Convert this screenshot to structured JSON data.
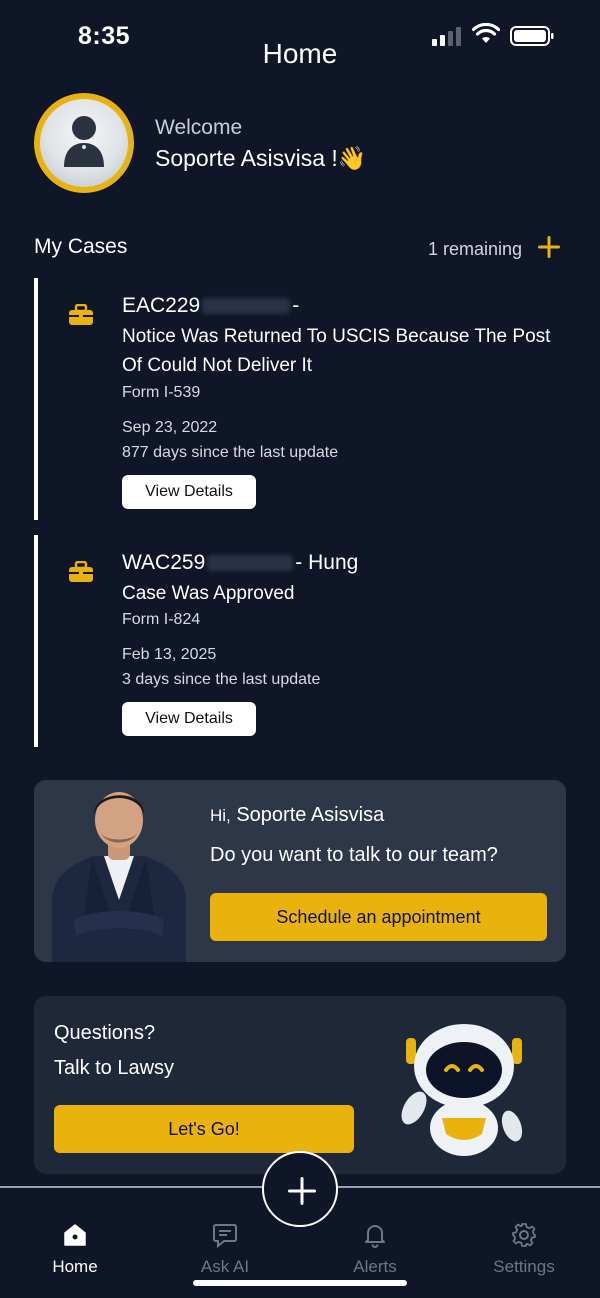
{
  "status_bar": {
    "time": "8:35"
  },
  "header": {
    "title": "Home"
  },
  "profile": {
    "welcome": "Welcome",
    "name": "Soporte Asisvisa !",
    "wave": "👋"
  },
  "cases_section": {
    "title": "My Cases",
    "remaining": "1 remaining"
  },
  "cases": [
    {
      "id_prefix": "EAC229",
      "id_suffix": "-",
      "status": "Notice Was Returned To USCIS Because The Post Of Could Not Deliver It",
      "form": "Form I-539",
      "date": "Sep 23, 2022",
      "days": "877 days since the last update",
      "button": "View Details"
    },
    {
      "id_prefix": "WAC259",
      "id_suffix": "- Hung",
      "status": "Case Was Approved",
      "form": "Form I-824",
      "date": "Feb 13, 2025",
      "days": "3 days since the last update",
      "button": "View Details"
    }
  ],
  "promo": {
    "hi_prefix": "Hi,",
    "hi_name": "Soporte Asisvisa",
    "question": "Do you want to talk to our team?",
    "button": "Schedule an appointment"
  },
  "lawsy": {
    "line1": "Questions?",
    "line2": "Talk to Lawsy",
    "button": "Let's Go!"
  },
  "tabs": [
    {
      "label": "Home",
      "icon": "home-icon",
      "active": true
    },
    {
      "label": "Ask AI",
      "icon": "chat-ai-icon",
      "active": false
    },
    {
      "label": "Alerts",
      "icon": "bell-icon",
      "active": false
    },
    {
      "label": "Settings",
      "icon": "gear-icon",
      "active": false
    }
  ],
  "colors": {
    "background": "#0f1628",
    "accent": "#e9b20d",
    "card": "#2e3747",
    "card_dark": "#1f2838"
  }
}
